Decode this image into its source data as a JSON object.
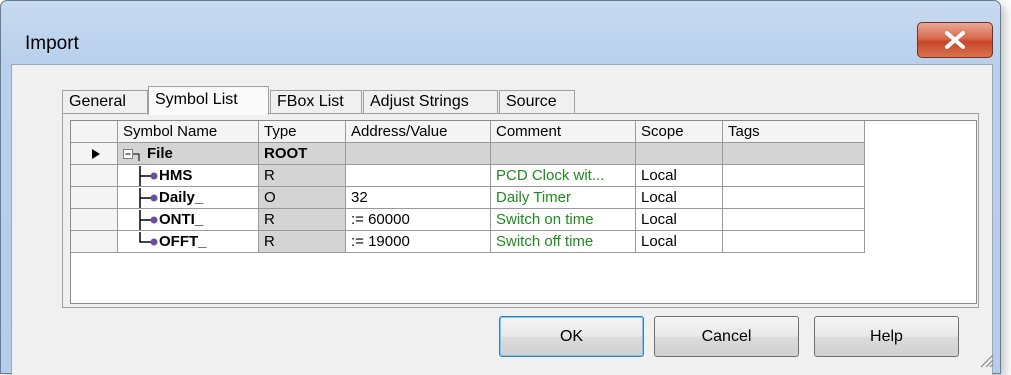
{
  "window": {
    "title": "Import"
  },
  "tabs": [
    {
      "label": "General"
    },
    {
      "label": "Symbol List"
    },
    {
      "label": "FBox List"
    },
    {
      "label": "Adjust Strings"
    },
    {
      "label": "Source"
    }
  ],
  "grid": {
    "columns": [
      "Symbol Name",
      "Type",
      "Address/Value",
      "Comment",
      "Scope",
      "Tags"
    ],
    "root": {
      "name": "File",
      "type": "ROOT"
    },
    "rows": [
      {
        "name": "HMS",
        "type": "R",
        "address": "",
        "comment": "PCD Clock wit...",
        "scope": "Local",
        "tags": ""
      },
      {
        "name": "Daily_",
        "type": "O",
        "address": "32",
        "comment": "Daily Timer",
        "scope": "Local",
        "tags": ""
      },
      {
        "name": "ONTI_",
        "type": "R",
        "address": ":= 60000",
        "comment": "Switch on time",
        "scope": "Local",
        "tags": ""
      },
      {
        "name": "OFFT_",
        "type": "R",
        "address": ":= 19000",
        "comment": "Switch off time",
        "scope": "Local",
        "tags": ""
      }
    ]
  },
  "buttons": {
    "ok": "OK",
    "cancel": "Cancel",
    "help": "Help"
  },
  "colors": {
    "comment_text": "#1f8a1f",
    "close_button": "#c7452a",
    "title_bar": "#b9d0ec"
  }
}
